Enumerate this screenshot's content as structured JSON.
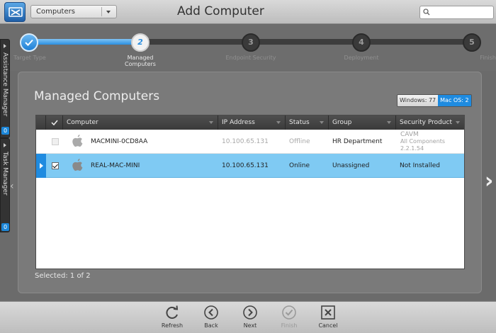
{
  "header": {
    "view_selector": "Computers",
    "title": "Add Computer",
    "search_placeholder": ""
  },
  "wizard": {
    "steps": [
      {
        "number": "",
        "label": "Target Type",
        "state": "done"
      },
      {
        "number": "2",
        "label": "Managed\nComputers",
        "state": "current"
      },
      {
        "number": "3",
        "label": "Endpoint Security",
        "state": "pending"
      },
      {
        "number": "4",
        "label": "Deployment",
        "state": "pending"
      },
      {
        "number": "5",
        "label": "Finish",
        "state": "pending"
      }
    ],
    "progress": 0.25
  },
  "side_tabs": {
    "assistance_manager": {
      "label": "Assistance Manager",
      "count": "0"
    },
    "task_manager": {
      "label": "Task Manager",
      "count": "0"
    }
  },
  "panel": {
    "title": "Managed Computers",
    "os_toggle": {
      "windows": "Windows: 77",
      "mac": "Mac OS: 2"
    }
  },
  "table": {
    "columns": [
      "Computer",
      "IP Address",
      "Status",
      "Group",
      "Security Product"
    ],
    "rows": [
      {
        "computer": "MACMINI-0CD8AA",
        "ip": "10.100.65.131",
        "status": "Offline",
        "group": "HR Department",
        "security_lines": [
          "CAVM",
          "All Components",
          "2.2.1.54"
        ],
        "checked": false,
        "selected": false
      },
      {
        "computer": "REAL-MAC-MINI",
        "ip": "10.100.65.131",
        "status": "Online",
        "group": "Unassigned",
        "security": "Not Installed",
        "checked": true,
        "selected": true
      }
    ]
  },
  "footer_status": "Selected: 1 of 2",
  "toolbar": {
    "refresh": "Refresh",
    "back": "Back",
    "next": "Next",
    "finish": "Finish",
    "cancel": "Cancel"
  },
  "colors": {
    "accent": "#1e8be0",
    "selected_row": "#7fcaf3"
  }
}
